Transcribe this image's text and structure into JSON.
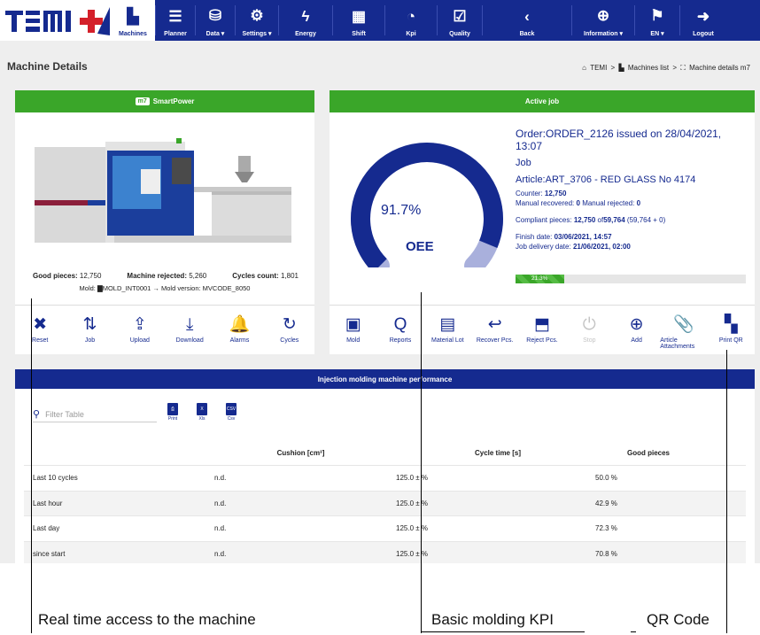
{
  "logo_text": "TEMI+",
  "nav": [
    {
      "label": "Machines",
      "icon": "factory-icon",
      "glyph": "▙"
    },
    {
      "label": "Planner",
      "icon": "list-icon",
      "glyph": "☰"
    },
    {
      "label": "Data ▾",
      "icon": "database-icon",
      "glyph": "⛁"
    },
    {
      "label": "Settings ▾",
      "icon": "gear-icon",
      "glyph": "⚙"
    },
    {
      "label": "Energy",
      "icon": "bolt-icon",
      "glyph": "ϟ"
    },
    {
      "label": "Shift",
      "icon": "calendar-icon",
      "glyph": "▦"
    },
    {
      "label": "Kpi",
      "icon": "gauge-icon",
      "glyph": "◔"
    },
    {
      "label": "Quality",
      "icon": "clipboard-check-icon",
      "glyph": "☑"
    },
    {
      "label": "Back",
      "icon": "chevron-left-icon",
      "glyph": "‹"
    },
    {
      "label": "Information ▾",
      "icon": "lifebuoy-icon",
      "glyph": "⊕"
    },
    {
      "label": "EN ▾",
      "icon": "flag-icon",
      "glyph": "⚑"
    },
    {
      "label": "Logout",
      "icon": "logout-icon",
      "glyph": "➜"
    }
  ],
  "page_title": "Machine Details",
  "breadcrumb": {
    "home": "TEMI",
    "sep": ">",
    "list": "Machines list",
    "current": "Machine details m7"
  },
  "left_card": {
    "badge": "m7",
    "title": "SmartPower",
    "good_label": "Good pieces:",
    "good_value": "12,750",
    "rejected_label": "Machine rejected:",
    "rejected_value": "5,260",
    "cycles_label": "Cycles count:",
    "cycles_value": "1,801",
    "mold_line": "Mold: ▇MOLD_INT0001 → Mold version: MVCODE_8050"
  },
  "left_actions": [
    {
      "label": "Reset",
      "icon": "close-circle-icon",
      "glyph": "✖"
    },
    {
      "label": "Job",
      "icon": "sort-icon",
      "glyph": "⇅"
    },
    {
      "label": "Upload",
      "icon": "upload-icon",
      "glyph": "⇪"
    },
    {
      "label": "Download",
      "icon": "download-icon",
      "glyph": "⤓"
    },
    {
      "label": "Alarms",
      "icon": "bell-icon",
      "glyph": "🔔"
    },
    {
      "label": "Cycles",
      "icon": "refresh-icon",
      "glyph": "↻"
    }
  ],
  "right_card": {
    "title": "Active job",
    "oee_value": "91.7%",
    "oee_fraction": 0.917,
    "oee_label": "OEE",
    "order": "Order:ORDER_2126 issued on 28/04/2021, 13:07",
    "job": "Job",
    "article": "Article:ART_3706 - RED GLASS No 4174",
    "counter_label": "Counter:",
    "counter_value": "12,750",
    "recovered_label": "Manual recovered:",
    "recovered_value": "0",
    "rejected_label": "Manual rejected:",
    "rejected_value": "0",
    "compliant_label": "Compliant pieces:",
    "compliant_value": "12,750",
    "compliant_of": "of",
    "compliant_total": "59,764",
    "compliant_detail": "(59,764 + 0)",
    "finish_label": "Finish date:",
    "finish_value": "03/06/2021, 14:57",
    "delivery_label": "Job delivery date:",
    "delivery_value": "21/06/2021, 02:00",
    "progress_text": "21.3%",
    "progress_fraction": 0.213
  },
  "right_actions": [
    {
      "label": "Mold",
      "icon": "mold-icon",
      "glyph": "▣",
      "disabled": false
    },
    {
      "label": "Reports",
      "icon": "reports-icon",
      "glyph": "Q",
      "disabled": false
    },
    {
      "label": "Material Lot",
      "icon": "material-icon",
      "glyph": "▤",
      "disabled": false
    },
    {
      "label": "Recover Pcs.",
      "icon": "recover-icon",
      "glyph": "↩",
      "disabled": false
    },
    {
      "label": "Reject Pcs.",
      "icon": "reject-icon",
      "glyph": "⬒",
      "disabled": false
    },
    {
      "label": "Stop",
      "icon": "power-icon",
      "glyph": "⏻",
      "disabled": true
    },
    {
      "label": "Add",
      "icon": "plus-circle-icon",
      "glyph": "⊕",
      "disabled": false
    },
    {
      "label": "Article Attachments",
      "icon": "paperclip-icon",
      "glyph": "📎",
      "disabled": false
    },
    {
      "label": "Print QR",
      "icon": "qr-icon",
      "glyph": "▚",
      "disabled": false
    }
  ],
  "performance": {
    "title": "Injection molding machine performance",
    "filter_placeholder": "Filter Table",
    "exports": [
      {
        "label": "Print",
        "icon": "print-icon",
        "glyph": "⎙"
      },
      {
        "label": "Xls",
        "icon": "xls-icon",
        "glyph": "X"
      },
      {
        "label": "Csv",
        "icon": "csv-icon",
        "glyph": "CSV"
      }
    ],
    "columns": [
      "",
      "Cushion [cm³]",
      "Cycle time [s]",
      "Good pieces"
    ],
    "rows": [
      [
        "Last 10 cycles",
        "n.d.",
        "125.0 ± %",
        "50.0 %"
      ],
      [
        "Last hour",
        "n.d.",
        "125.0 ± %",
        "42.9 %"
      ],
      [
        "Last day",
        "n.d.",
        "125.0 ± %",
        "72.3 %"
      ],
      [
        "since start",
        "n.d.",
        "125.0 ± %",
        "70.8 %"
      ]
    ]
  },
  "annotations": {
    "left": "Real time access to the machine",
    "middle": "Basic molding KPI",
    "right": "QR Code"
  },
  "colors": {
    "brand_blue": "#152a8f",
    "green": "#3aa629",
    "logo_red": "#d4202a"
  }
}
